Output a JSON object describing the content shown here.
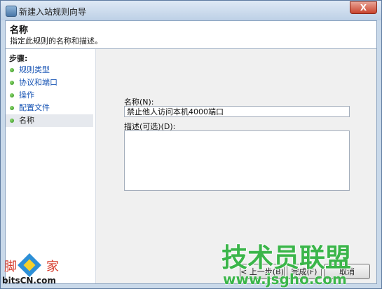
{
  "window": {
    "title": "新建入站规则向导",
    "close_label": "X"
  },
  "header": {
    "title": "名称",
    "subtitle": "指定此规则的名称和描述。"
  },
  "sidebar": {
    "steps_label": "步骤:",
    "items": [
      {
        "label": "规则类型",
        "current": false
      },
      {
        "label": "协议和端口",
        "current": false
      },
      {
        "label": "操作",
        "current": false
      },
      {
        "label": "配置文件",
        "current": false
      },
      {
        "label": "名称",
        "current": true
      }
    ]
  },
  "form": {
    "name_label": "名称(N):",
    "name_value": "禁止他人访问本机4000端口",
    "desc_label": "描述(可选)(D):",
    "desc_value": ""
  },
  "buttons": {
    "back": "< 上一步(B)",
    "finish": "完成(F)",
    "cancel": "取消"
  },
  "watermarks": {
    "left_top": "脚",
    "left_top2": "家",
    "left_bottom": "bitsCN.com",
    "right_top": "技术员联盟",
    "right_bottom": "www.jsgho.com"
  },
  "colors": {
    "link": "#1a56b5",
    "dot": "#2c8a1d",
    "watermark_green": "#3bb54a"
  }
}
